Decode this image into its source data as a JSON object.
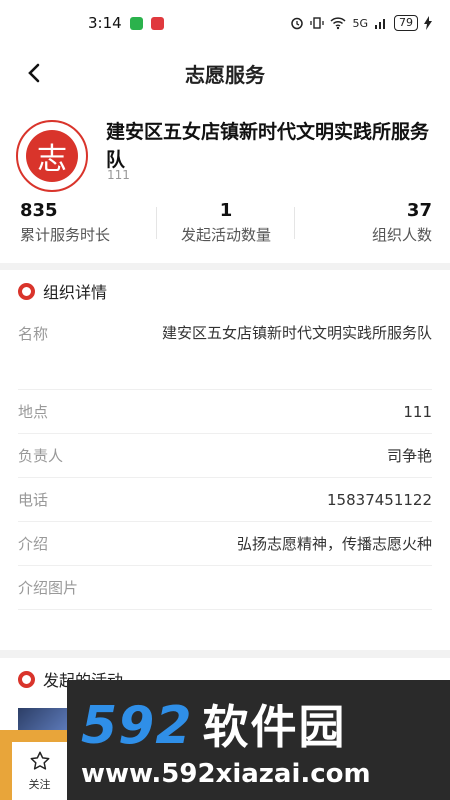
{
  "status": {
    "time": "3:14",
    "network": "5G",
    "battery": "79"
  },
  "nav": {
    "title": "志愿服务"
  },
  "org": {
    "name": "建安区五女店镇新时代文明实践所服务队",
    "sub": "111",
    "logo_char": "志"
  },
  "stats": [
    {
      "value": "835",
      "label": "累计服务时长"
    },
    {
      "value": "1",
      "label": "发起活动数量"
    },
    {
      "value": "37",
      "label": "组织人数"
    }
  ],
  "detail": {
    "title": "组织详情",
    "rows": [
      {
        "key": "名称",
        "value": "建安区五女店镇新时代文明实践所服务队"
      },
      {
        "key": "地点",
        "value": "111"
      },
      {
        "key": "负责人",
        "value": "司争艳"
      },
      {
        "key": "电话",
        "value": "15837451122"
      },
      {
        "key": "介绍",
        "value": "弘扬志愿精神，传播志愿火种"
      },
      {
        "key": "介绍图片",
        "value": ""
      }
    ]
  },
  "activities": {
    "title": "发起的活动"
  },
  "follow": {
    "label": "关注"
  },
  "watermark": {
    "brand_num": "592",
    "brand_text": "软件园",
    "url": "www.592xiazai.com"
  },
  "colors": {
    "accent": "#d9342b",
    "watermark_blue": "#2f8fe8"
  }
}
